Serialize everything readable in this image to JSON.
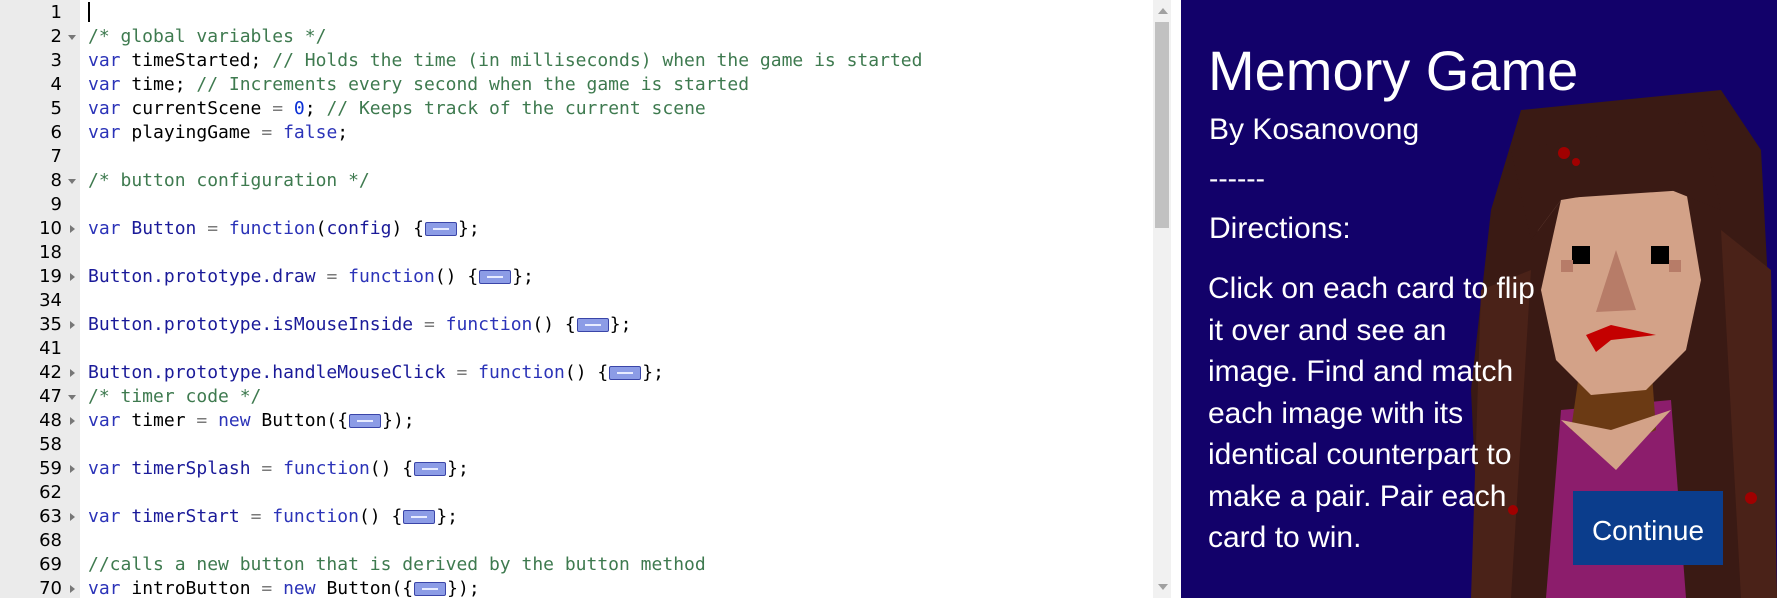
{
  "editor": {
    "lines": [
      {
        "num": "1",
        "fold": "",
        "tokens": []
      },
      {
        "num": "2",
        "fold": "open",
        "tokens": [
          {
            "t": "/* global variables */",
            "c": "cm"
          }
        ]
      },
      {
        "num": "3",
        "fold": "",
        "tokens": [
          {
            "t": "var",
            "c": "kw"
          },
          {
            "t": " timeStarted; ",
            "c": "id"
          },
          {
            "t": "// Holds the time (in milliseconds) when the game is started",
            "c": "cm"
          }
        ]
      },
      {
        "num": "4",
        "fold": "",
        "tokens": [
          {
            "t": "var",
            "c": "kw"
          },
          {
            "t": " time; ",
            "c": "id"
          },
          {
            "t": "// Increments every second when the game is started",
            "c": "cm"
          }
        ]
      },
      {
        "num": "5",
        "fold": "",
        "tokens": [
          {
            "t": "var",
            "c": "kw"
          },
          {
            "t": " currentScene ",
            "c": "id"
          },
          {
            "t": "=",
            "c": "op"
          },
          {
            "t": " ",
            "c": "id"
          },
          {
            "t": "0",
            "c": "num"
          },
          {
            "t": "; ",
            "c": "id"
          },
          {
            "t": "// Keeps track of the current scene",
            "c": "cm"
          }
        ]
      },
      {
        "num": "6",
        "fold": "",
        "tokens": [
          {
            "t": "var",
            "c": "kw"
          },
          {
            "t": " playingGame ",
            "c": "id"
          },
          {
            "t": "=",
            "c": "op"
          },
          {
            "t": " ",
            "c": "id"
          },
          {
            "t": "false",
            "c": "bool"
          },
          {
            "t": ";",
            "c": "id"
          }
        ]
      },
      {
        "num": "7",
        "fold": "",
        "tokens": []
      },
      {
        "num": "8",
        "fold": "open",
        "tokens": [
          {
            "t": "/* button configuration */",
            "c": "cm"
          }
        ]
      },
      {
        "num": "9",
        "fold": "",
        "tokens": []
      },
      {
        "num": "10",
        "fold": "closed",
        "tokens": [
          {
            "t": "var",
            "c": "kw"
          },
          {
            "t": " Button ",
            "c": "prop"
          },
          {
            "t": "=",
            "c": "op"
          },
          {
            "t": " ",
            "c": "id"
          },
          {
            "t": "function",
            "c": "kw"
          },
          {
            "t": "(",
            "c": "id"
          },
          {
            "t": "config",
            "c": "prop"
          },
          {
            "t": ") {",
            "c": "id"
          },
          {
            "t": "",
            "c": "marker"
          },
          {
            "t": "};",
            "c": "id"
          }
        ]
      },
      {
        "num": "18",
        "fold": "",
        "tokens": []
      },
      {
        "num": "19",
        "fold": "closed",
        "tokens": [
          {
            "t": "Button",
            "c": "prop"
          },
          {
            "t": ".prototype.",
            "c": "prop"
          },
          {
            "t": "draw",
            "c": "prop"
          },
          {
            "t": " ",
            "c": "id"
          },
          {
            "t": "=",
            "c": "op"
          },
          {
            "t": " ",
            "c": "id"
          },
          {
            "t": "function",
            "c": "kw"
          },
          {
            "t": "() {",
            "c": "id"
          },
          {
            "t": "",
            "c": "marker"
          },
          {
            "t": "};",
            "c": "id"
          }
        ]
      },
      {
        "num": "34",
        "fold": "",
        "tokens": []
      },
      {
        "num": "35",
        "fold": "closed",
        "tokens": [
          {
            "t": "Button",
            "c": "prop"
          },
          {
            "t": ".prototype.",
            "c": "prop"
          },
          {
            "t": "isMouseInside",
            "c": "prop"
          },
          {
            "t": " ",
            "c": "id"
          },
          {
            "t": "=",
            "c": "op"
          },
          {
            "t": " ",
            "c": "id"
          },
          {
            "t": "function",
            "c": "kw"
          },
          {
            "t": "() {",
            "c": "id"
          },
          {
            "t": "",
            "c": "marker"
          },
          {
            "t": "};",
            "c": "id"
          }
        ]
      },
      {
        "num": "41",
        "fold": "",
        "tokens": []
      },
      {
        "num": "42",
        "fold": "closed",
        "tokens": [
          {
            "t": "Button",
            "c": "prop"
          },
          {
            "t": ".prototype.",
            "c": "prop"
          },
          {
            "t": "handleMouseClick",
            "c": "prop"
          },
          {
            "t": " ",
            "c": "id"
          },
          {
            "t": "=",
            "c": "op"
          },
          {
            "t": " ",
            "c": "id"
          },
          {
            "t": "function",
            "c": "kw"
          },
          {
            "t": "() {",
            "c": "id"
          },
          {
            "t": "",
            "c": "marker"
          },
          {
            "t": "};",
            "c": "id"
          }
        ]
      },
      {
        "num": "47",
        "fold": "open",
        "tokens": [
          {
            "t": "/* timer code */",
            "c": "cm"
          }
        ]
      },
      {
        "num": "48",
        "fold": "closed",
        "tokens": [
          {
            "t": "var",
            "c": "kw"
          },
          {
            "t": " timer ",
            "c": "id"
          },
          {
            "t": "=",
            "c": "op"
          },
          {
            "t": " ",
            "c": "id"
          },
          {
            "t": "new",
            "c": "kw"
          },
          {
            "t": " Button({",
            "c": "id"
          },
          {
            "t": "",
            "c": "marker"
          },
          {
            "t": "});",
            "c": "id"
          }
        ]
      },
      {
        "num": "58",
        "fold": "",
        "tokens": []
      },
      {
        "num": "59",
        "fold": "closed",
        "tokens": [
          {
            "t": "var",
            "c": "kw"
          },
          {
            "t": " timerSplash ",
            "c": "prop"
          },
          {
            "t": "=",
            "c": "op"
          },
          {
            "t": " ",
            "c": "id"
          },
          {
            "t": "function",
            "c": "kw"
          },
          {
            "t": "() {",
            "c": "id"
          },
          {
            "t": "",
            "c": "marker"
          },
          {
            "t": "};",
            "c": "id"
          }
        ]
      },
      {
        "num": "62",
        "fold": "",
        "tokens": []
      },
      {
        "num": "63",
        "fold": "closed",
        "tokens": [
          {
            "t": "var",
            "c": "kw"
          },
          {
            "t": " timerStart ",
            "c": "prop"
          },
          {
            "t": "=",
            "c": "op"
          },
          {
            "t": " ",
            "c": "id"
          },
          {
            "t": "function",
            "c": "kw"
          },
          {
            "t": "() {",
            "c": "id"
          },
          {
            "t": "",
            "c": "marker"
          },
          {
            "t": "};",
            "c": "id"
          }
        ]
      },
      {
        "num": "68",
        "fold": "",
        "tokens": []
      },
      {
        "num": "69",
        "fold": "",
        "tokens": [
          {
            "t": "//calls a new button that is derived by the button method",
            "c": "cm"
          }
        ]
      },
      {
        "num": "70",
        "fold": "closed",
        "tokens": [
          {
            "t": "var",
            "c": "kw"
          },
          {
            "t": " introButton ",
            "c": "id"
          },
          {
            "t": "=",
            "c": "op"
          },
          {
            "t": " ",
            "c": "id"
          },
          {
            "t": "new",
            "c": "kw"
          },
          {
            "t": " Button({",
            "c": "id"
          },
          {
            "t": "",
            "c": "marker"
          },
          {
            "t": "});",
            "c": "id"
          }
        ]
      }
    ]
  },
  "canvas": {
    "title": "Memory Game",
    "byline": "By Kosanovong",
    "divider": "------",
    "directions_heading": "Directions:",
    "directions_body": "Click on each card to flip it over and see an image. Find and match each image with its identical counterpart to make a pair. Pair each card to win.",
    "continue_label": "Continue",
    "background_color": "#12016a",
    "button_color": "#0b3d8c"
  }
}
